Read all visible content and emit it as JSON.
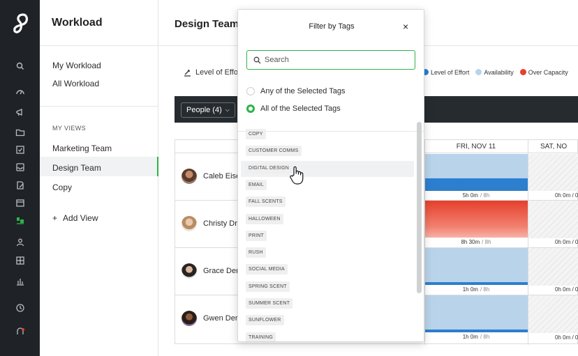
{
  "sidebar": {
    "title": "Workload",
    "items": [
      "My Workload",
      "All Workload"
    ],
    "views_label": "MY VIEWS",
    "views": [
      "Marketing Team",
      "Design Team",
      "Copy"
    ],
    "add_view": "Add View"
  },
  "main": {
    "title": "Design Team",
    "loe_button": "Level of Effo",
    "legend": [
      {
        "label": "Level of Effort",
        "color": "#2a7fd4"
      },
      {
        "label": "Availability",
        "color": "#b9d3ea"
      },
      {
        "label": "Over Capacity",
        "color": "#e5402c"
      }
    ],
    "people_button": "People (4)",
    "columns": [
      "FRI, NOV 11",
      "SAT, NO"
    ],
    "people": [
      {
        "name": "Caleb Eise",
        "fri": "5h 0m",
        "fri_cap": "/ 8h",
        "sat": "0h 0m / 0",
        "fri_fill": 0.625
      },
      {
        "name": "Christy Dr",
        "fri": "8h 30m",
        "fri_cap": "/ 8h",
        "sat": "0h 0m / 0",
        "fri_fill": 1.06
      },
      {
        "name": "Grace Der",
        "fri": "1h 0m",
        "fri_cap": "/ 8h",
        "sat": "0h 0m / 0",
        "fri_fill": 0.125
      },
      {
        "name": "Gwen Der",
        "fri": "1h 0m",
        "fri_cap": "/ 8h",
        "sat": "0h 0m / 0",
        "fri_fill": 0.125
      }
    ]
  },
  "filter": {
    "title": "Filter by Tags",
    "close": "×",
    "search_placeholder": "Search",
    "options": [
      "Any of the Selected Tags",
      "All of the Selected Tags"
    ],
    "selected_option": "All of the Selected Tags",
    "tags": [
      "COPY",
      "CUSTOMER COMMS",
      "DIGITAL DESIGN",
      "EMAIL",
      "FALL SCENTS",
      "HALLOWEEN",
      "PRINT",
      "RUSH",
      "SOCIAL MEDIA",
      "SPRING SCENT",
      "SUMMER SCENT",
      "SUNFLOWER",
      "TRAINING"
    ],
    "hovered_tag": "DIGITAL DESIGN"
  },
  "colors": {
    "accent": "#2db34a",
    "rail": "#1f2328",
    "effort_blue": "#2a7fd4",
    "availability": "#b9d3ea",
    "over": "#e5402c"
  }
}
